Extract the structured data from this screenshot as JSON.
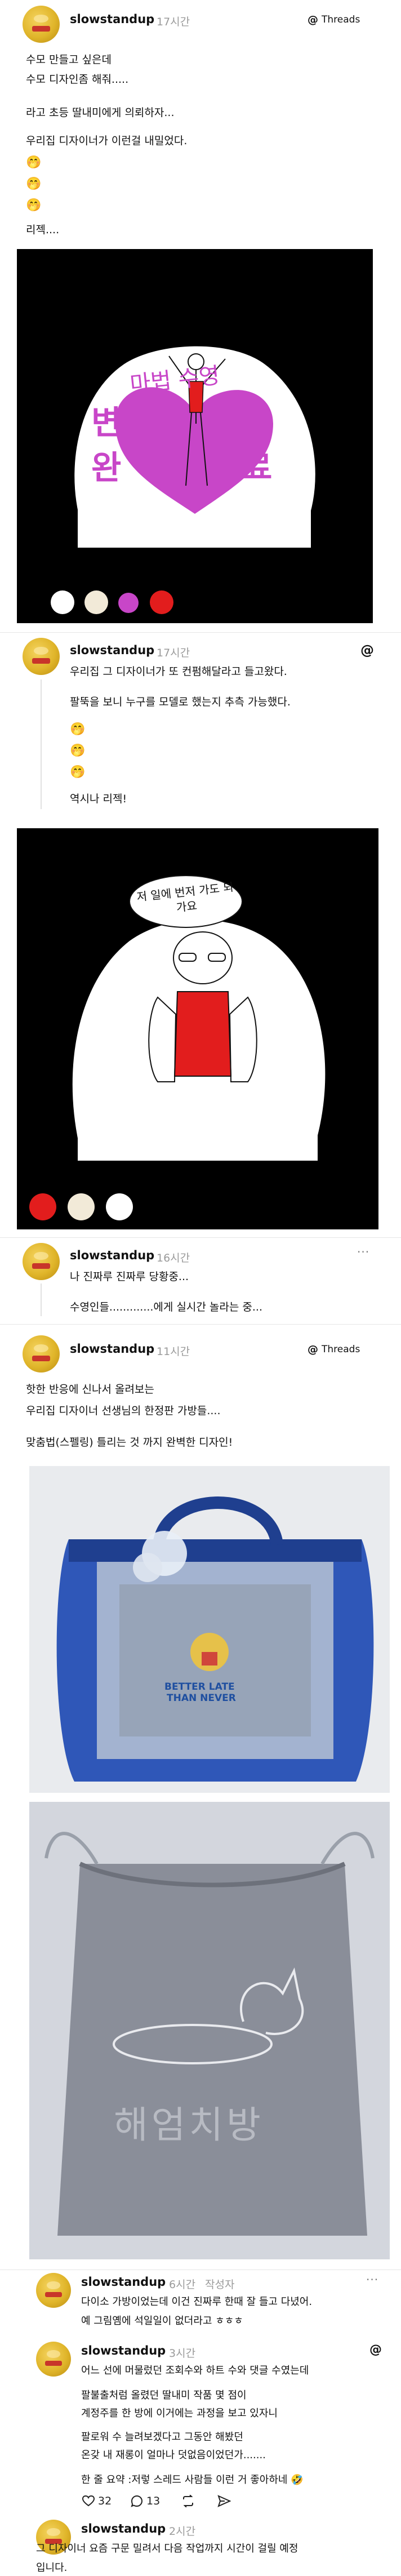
{
  "post1": {
    "username": "slowstandup",
    "time": "17시간",
    "threads_label": "Threads",
    "lines": [
      "수모 만들고 싶은데",
      "수모 디자인좀 해줘.....",
      "라고 초등 딸내미에게 의뢰하자...",
      "우리집 디자이너가 이런걸 내밀었다.",
      "리젝...."
    ],
    "emoji": [
      "🤭",
      "🤭",
      "🤭"
    ],
    "drawing_text_top": "마법 수영",
    "drawing_text_left": "변 완",
    "drawing_text_right": "신 료",
    "swatch_colors": [
      "#ffffff",
      "#f2ead8",
      "#c846c8",
      "#e21d1d"
    ]
  },
  "reply1": {
    "username": "slowstandup",
    "time": "17시간",
    "lines": [
      "우리집 그 디자이너가 또 컨펌해달라고 들고왔다.",
      "팔뚝을 보니 누구를 모델로 했는지 추측 가능했다.",
      "역시나 리젝!"
    ],
    "emoji": [
      "🤭",
      "🤭",
      "🤭"
    ],
    "drawing_bubble": "저 일에 번저 가도 되가요",
    "swatch_colors": [
      "#e21d1d",
      "#f2ead8",
      "#ffffff"
    ]
  },
  "reply2": {
    "username": "slowstandup",
    "time": "16시간",
    "more": "···",
    "line1": "나 진짜루 진짜루 당황중...",
    "line2": "수영인들.............에게 실시간 놀라는 중..."
  },
  "post2": {
    "username": "slowstandup",
    "time": "11시간",
    "threads_label": "Threads",
    "lines": [
      "핫한 반응에 신나서 올려보는",
      "우리집 디자이너 선생님의 한정판 가방들....",
      "맞춤법(스펠링) 틀리는 것 까지 완벽한 디자인!"
    ],
    "bag_text_1": "BETTER LATE",
    "bag_text_2": "THAN NEVER",
    "pouch_text": "해엄치방"
  },
  "comment1": {
    "username": "slowstandup",
    "time": "6시간",
    "author_tag": "작성자",
    "more": "···",
    "line1": "다이소 가방이었는데 이건 진짜루 한때 잘 들고 다녔어.",
    "line2": "예 그림옘에 석일일이 없더라고 ㅎㅎㅎ"
  },
  "comment2": {
    "username": "slowstandup",
    "time": "3시간",
    "lines": [
      "어느 선에 머물렀던 조회수와 하트 수와 댓글 수였는데",
      "팔불출처럼 올렸던 딸내미 작품 몇 점이",
      "계정주를 한 방에 이거에는 과정을 보고 있자니",
      "팔로워 수 늘려보겠다고 그동안 해봤던",
      "온갖 내 재롱이 얼마나 덧없음이었던가.......",
      "한 줄 요약 :저렇 스레드 사람들 이런 거 좋아하네"
    ],
    "emoji": "🤣",
    "likes": "32",
    "replies": "13"
  },
  "comment3": {
    "username": "slowstandup",
    "time": "2시간",
    "line1": "그 디자이너 요즘 구문 밀려서 다음 작업까지 시간이 걸릴 예정",
    "line2": "입니다."
  }
}
